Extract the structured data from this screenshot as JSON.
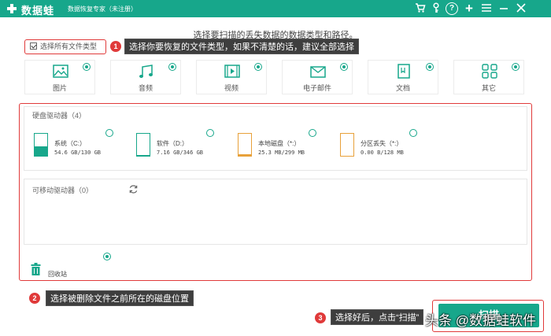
{
  "app": {
    "name": "数据蛙",
    "subtitle": "数据恢复专家（未注册）"
  },
  "titlebar": {
    "icons": [
      "shop-cart-icon",
      "key-icon",
      "help-icon",
      "plus-icon",
      "menu-icon",
      "minimize-icon",
      "close-icon"
    ]
  },
  "instruction": "选择要扫描的丢失数据的数据类型和路径。",
  "select_all": {
    "label": "选择所有文件类型",
    "checked": true
  },
  "callouts": [
    {
      "number": "1",
      "text": "选择你要恢复的文件类型，如果不清楚的话，建议全部选择"
    },
    {
      "number": "2",
      "text": "选择被删除文件之前所在的磁盘位置"
    },
    {
      "number": "3",
      "text": "选择好后，点击“扫描”"
    }
  ],
  "file_types": [
    {
      "label": "图片",
      "icon": "image-icon",
      "selected": true
    },
    {
      "label": "音频",
      "icon": "music-icon",
      "selected": true
    },
    {
      "label": "视频",
      "icon": "video-icon",
      "selected": true
    },
    {
      "label": "电子邮件",
      "icon": "email-icon",
      "selected": true
    },
    {
      "label": "文档",
      "icon": "document-icon",
      "selected": true
    },
    {
      "label": "其它",
      "icon": "other-icon",
      "selected": true
    }
  ],
  "hard_drives": {
    "title": "硬盘驱动器（4）",
    "drives": [
      {
        "name": "系统（C:）",
        "size": "54.6 GB/130 GB",
        "fill": 0.42,
        "selected": false
      },
      {
        "name": "软件（D:）",
        "size": "7.16 GB/346 GB",
        "fill": 0.02,
        "selected": false
      },
      {
        "name": "本地磁盘（*:）",
        "size": "25.3 MB/299 MB",
        "fill": 0.08,
        "selected": false
      },
      {
        "name": "分区丢失（*:）",
        "size": "0.00  B/128 MB",
        "fill": 0.0,
        "selected": false
      }
    ]
  },
  "removable_drives": {
    "title": "可移动驱动器（0）"
  },
  "recycle_bin": {
    "label": "回收站",
    "selected": true
  },
  "scan_button": {
    "label": "扫描"
  },
  "watermark": "头条 @数据蛙软件",
  "colors": {
    "brand": "#17a78b",
    "highlight": "#e03a3a",
    "callout_bg": "#3e3e3e"
  }
}
